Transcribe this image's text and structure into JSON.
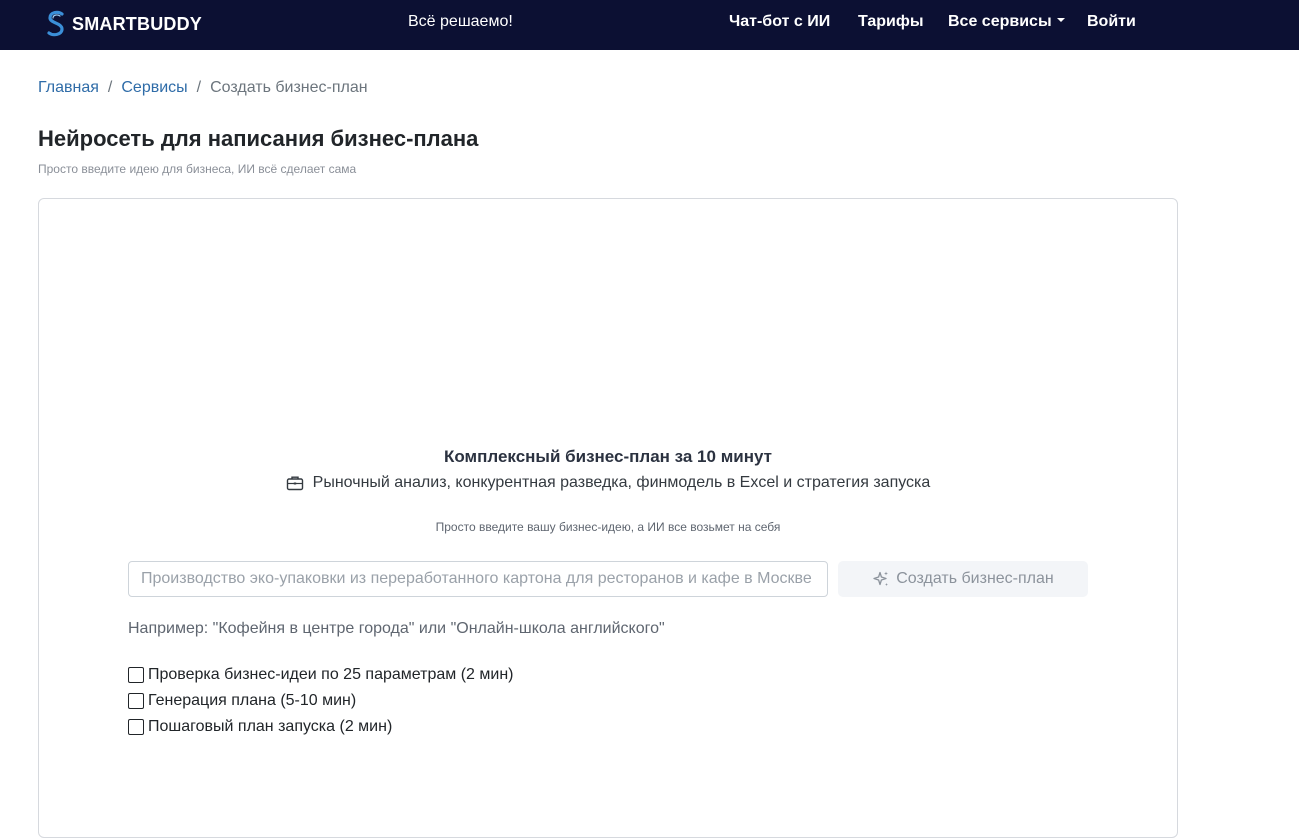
{
  "header": {
    "logo_text": "SMARTBUDDY",
    "slogan": "Всё решаемо!",
    "nav": {
      "chatbot": "Чат-бот с ИИ",
      "pricing": "Тарифы",
      "services": "Все сервисы",
      "login": "Войти"
    }
  },
  "breadcrumb": {
    "home": "Главная",
    "separator": "/",
    "services": "Сервисы",
    "current": "Создать бизнес-план"
  },
  "page": {
    "title": "Нейросеть для написания бизнес-плана",
    "subtitle": "Просто введите идею для бизнеса, ИИ всё сделает сама"
  },
  "card": {
    "title": "Комплексный бизнес-план за 10 минут",
    "description": "Рыночный анализ, конкурентная разведка, финмодель в Excel и стратегия запуска",
    "description_icon": "briefcase-icon",
    "hint": "Просто введите вашу бизнес-идею, а ИИ все возьмет на себя",
    "input_placeholder": "Производство эко-упаковки из переработанного картона для ресторанов и кафе в Москве",
    "input_value": "",
    "button_label": "Создать бизнес-план",
    "button_icon": "sparkles-icon",
    "example": "Например: \"Кофейня в центре города\" или \"Онлайн-школа английского\"",
    "checklist": [
      {
        "label": "Проверка бизнес-идеи по 25 параметрам (2 мин)",
        "checked": false
      },
      {
        "label": "Генерация плана (5-10 мин)",
        "checked": false
      },
      {
        "label": "Пошаговый план запуска (2 мин)",
        "checked": false
      }
    ]
  },
  "colors": {
    "navbar_bg": "#0c1033",
    "link": "#2f6ca8",
    "logo_accent": "#3b8fd8"
  }
}
